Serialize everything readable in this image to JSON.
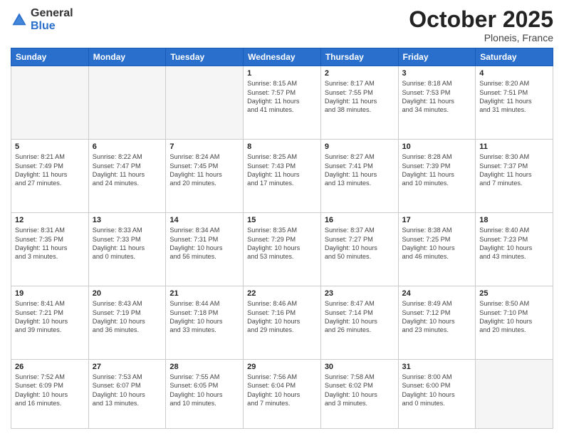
{
  "header": {
    "logo_general": "General",
    "logo_blue": "Blue",
    "month": "October 2025",
    "location": "Ploneis, France"
  },
  "weekdays": [
    "Sunday",
    "Monday",
    "Tuesday",
    "Wednesday",
    "Thursday",
    "Friday",
    "Saturday"
  ],
  "weeks": [
    [
      {
        "day": "",
        "info": ""
      },
      {
        "day": "",
        "info": ""
      },
      {
        "day": "",
        "info": ""
      },
      {
        "day": "1",
        "info": "Sunrise: 8:15 AM\nSunset: 7:57 PM\nDaylight: 11 hours\nand 41 minutes."
      },
      {
        "day": "2",
        "info": "Sunrise: 8:17 AM\nSunset: 7:55 PM\nDaylight: 11 hours\nand 38 minutes."
      },
      {
        "day": "3",
        "info": "Sunrise: 8:18 AM\nSunset: 7:53 PM\nDaylight: 11 hours\nand 34 minutes."
      },
      {
        "day": "4",
        "info": "Sunrise: 8:20 AM\nSunset: 7:51 PM\nDaylight: 11 hours\nand 31 minutes."
      }
    ],
    [
      {
        "day": "5",
        "info": "Sunrise: 8:21 AM\nSunset: 7:49 PM\nDaylight: 11 hours\nand 27 minutes."
      },
      {
        "day": "6",
        "info": "Sunrise: 8:22 AM\nSunset: 7:47 PM\nDaylight: 11 hours\nand 24 minutes."
      },
      {
        "day": "7",
        "info": "Sunrise: 8:24 AM\nSunset: 7:45 PM\nDaylight: 11 hours\nand 20 minutes."
      },
      {
        "day": "8",
        "info": "Sunrise: 8:25 AM\nSunset: 7:43 PM\nDaylight: 11 hours\nand 17 minutes."
      },
      {
        "day": "9",
        "info": "Sunrise: 8:27 AM\nSunset: 7:41 PM\nDaylight: 11 hours\nand 13 minutes."
      },
      {
        "day": "10",
        "info": "Sunrise: 8:28 AM\nSunset: 7:39 PM\nDaylight: 11 hours\nand 10 minutes."
      },
      {
        "day": "11",
        "info": "Sunrise: 8:30 AM\nSunset: 7:37 PM\nDaylight: 11 hours\nand 7 minutes."
      }
    ],
    [
      {
        "day": "12",
        "info": "Sunrise: 8:31 AM\nSunset: 7:35 PM\nDaylight: 11 hours\nand 3 minutes."
      },
      {
        "day": "13",
        "info": "Sunrise: 8:33 AM\nSunset: 7:33 PM\nDaylight: 11 hours\nand 0 minutes."
      },
      {
        "day": "14",
        "info": "Sunrise: 8:34 AM\nSunset: 7:31 PM\nDaylight: 10 hours\nand 56 minutes."
      },
      {
        "day": "15",
        "info": "Sunrise: 8:35 AM\nSunset: 7:29 PM\nDaylight: 10 hours\nand 53 minutes."
      },
      {
        "day": "16",
        "info": "Sunrise: 8:37 AM\nSunset: 7:27 PM\nDaylight: 10 hours\nand 50 minutes."
      },
      {
        "day": "17",
        "info": "Sunrise: 8:38 AM\nSunset: 7:25 PM\nDaylight: 10 hours\nand 46 minutes."
      },
      {
        "day": "18",
        "info": "Sunrise: 8:40 AM\nSunset: 7:23 PM\nDaylight: 10 hours\nand 43 minutes."
      }
    ],
    [
      {
        "day": "19",
        "info": "Sunrise: 8:41 AM\nSunset: 7:21 PM\nDaylight: 10 hours\nand 39 minutes."
      },
      {
        "day": "20",
        "info": "Sunrise: 8:43 AM\nSunset: 7:19 PM\nDaylight: 10 hours\nand 36 minutes."
      },
      {
        "day": "21",
        "info": "Sunrise: 8:44 AM\nSunset: 7:18 PM\nDaylight: 10 hours\nand 33 minutes."
      },
      {
        "day": "22",
        "info": "Sunrise: 8:46 AM\nSunset: 7:16 PM\nDaylight: 10 hours\nand 29 minutes."
      },
      {
        "day": "23",
        "info": "Sunrise: 8:47 AM\nSunset: 7:14 PM\nDaylight: 10 hours\nand 26 minutes."
      },
      {
        "day": "24",
        "info": "Sunrise: 8:49 AM\nSunset: 7:12 PM\nDaylight: 10 hours\nand 23 minutes."
      },
      {
        "day": "25",
        "info": "Sunrise: 8:50 AM\nSunset: 7:10 PM\nDaylight: 10 hours\nand 20 minutes."
      }
    ],
    [
      {
        "day": "26",
        "info": "Sunrise: 7:52 AM\nSunset: 6:09 PM\nDaylight: 10 hours\nand 16 minutes."
      },
      {
        "day": "27",
        "info": "Sunrise: 7:53 AM\nSunset: 6:07 PM\nDaylight: 10 hours\nand 13 minutes."
      },
      {
        "day": "28",
        "info": "Sunrise: 7:55 AM\nSunset: 6:05 PM\nDaylight: 10 hours\nand 10 minutes."
      },
      {
        "day": "29",
        "info": "Sunrise: 7:56 AM\nSunset: 6:04 PM\nDaylight: 10 hours\nand 7 minutes."
      },
      {
        "day": "30",
        "info": "Sunrise: 7:58 AM\nSunset: 6:02 PM\nDaylight: 10 hours\nand 3 minutes."
      },
      {
        "day": "31",
        "info": "Sunrise: 8:00 AM\nSunset: 6:00 PM\nDaylight: 10 hours\nand 0 minutes."
      },
      {
        "day": "",
        "info": ""
      }
    ]
  ]
}
